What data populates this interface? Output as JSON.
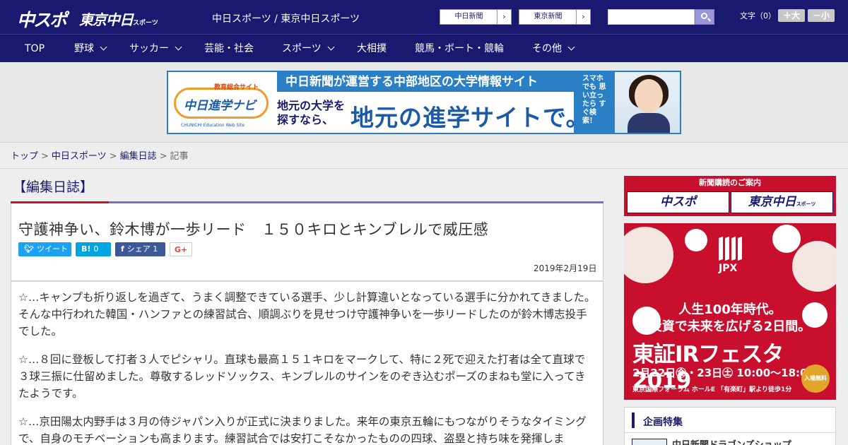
{
  "header": {
    "logo_main": "中スポ",
    "logo_tokyo": "東京中日",
    "logo_tokyo_suffix": "スポーツ",
    "site_title": "中日スポーツ / 東京中日スポーツ",
    "ext_links": [
      {
        "label": "中日新聞",
        "arrow": "›"
      },
      {
        "label": "東京新聞",
        "arrow": "›"
      }
    ],
    "search": {
      "value": ""
    },
    "font_size_label": "文字（0）",
    "font_bigger": "＋大",
    "font_smaller": "－小"
  },
  "nav": {
    "items": [
      {
        "label": "TOP",
        "dropdown": false
      },
      {
        "label": "野球",
        "dropdown": true
      },
      {
        "label": "サッカー",
        "dropdown": true
      },
      {
        "label": "芸能・社会",
        "dropdown": false
      },
      {
        "label": "スポーツ",
        "dropdown": true
      },
      {
        "label": "大相撲",
        "dropdown": false
      },
      {
        "label": "競馬・ボート・競輪",
        "dropdown": false
      },
      {
        "label": "その他",
        "dropdown": true
      }
    ]
  },
  "ad_banner": {
    "logo_top": "教育総合サイト",
    "logo_text": "中日進学ナビ",
    "logo_sub": "CHUNICHI Education Web Site",
    "headline": "中日新聞が運営する中部地区の大学情報サイト",
    "sub_left": "地元の大学を 探すなら、",
    "big_text": "地元の進学サイトで。",
    "vertical_text": "スマホでも 思い立ったら すぐ検索！"
  },
  "breadcrumb": {
    "items": [
      "トップ",
      "中日スポーツ",
      "編集日誌"
    ],
    "current": "記事",
    "separator": ">"
  },
  "article": {
    "section": "【編集日誌】",
    "title": "守護神争い、鈴木博が一歩リード　１５０キロとキンブレルで威圧感",
    "share": {
      "tweet": "ツイート",
      "hatena_icon": "B!",
      "hatena_count": "0",
      "facebook_icon": "f",
      "facebook_label": "シェア",
      "facebook_count": "1",
      "google_plus": "G+"
    },
    "date": "2019年2月19日",
    "paragraphs": [
      "☆…キャンプも折り返しを過ぎて、うまく調整できている選手、少し計算違いとなっている選手に分かれてきました。そんな中行われた韓国・ハンファとの練習試合、順調ぶりを見せつけ守護神争いを一歩リードしたのが鈴木博志投手でした。",
      "☆…８回に登板して打者３人でピシャリ。直球も最高１５１キロをマークして、特に２死で迎えた打者は全て直球で３球三振に仕留めました。尊敬するレッドソックス、キンブレルのサインをのぞき込むポーズのまねも堂に入ってきたようです。",
      "☆…京田陽太内野手は３月の侍ジャパン入りが正式に決まりました。来年の東京五輪にもつながりそうなタイミングで、自身のモチベーションも高まります。練習試合では安打こそなかったものの四球、盗塁と持ち味を発揮しま"
    ]
  },
  "sidebar": {
    "subscribe": {
      "title": "新聞購読のご案内",
      "buttons": [
        {
          "label": "中スポ",
          "suffix": ""
        },
        {
          "label": "東京中日",
          "suffix": "スポーツ"
        }
      ]
    },
    "jpx_ad": {
      "brand": "JPX",
      "line1": "人生100年時代。",
      "line2": "投資で未来を広げる2日間。",
      "big": "東証IRフェスタ2019",
      "dates": "2月22日㊎・23日㊏ 10:00～18:00",
      "venue": "東京国際フォーラム ホールE 「有楽町」駅より徒歩1分",
      "free": "入場無料"
    },
    "feature": {
      "heading": "企画特集",
      "first_item": "中日新聞ドラゴンズショップ"
    }
  },
  "colors": {
    "header_navy": "#1a1970",
    "accent_red": "#c8102e",
    "accent_purple": "#7a70b8",
    "twitter": "#1da1f2",
    "hatena": "#00a4de",
    "facebook": "#3b5998"
  }
}
